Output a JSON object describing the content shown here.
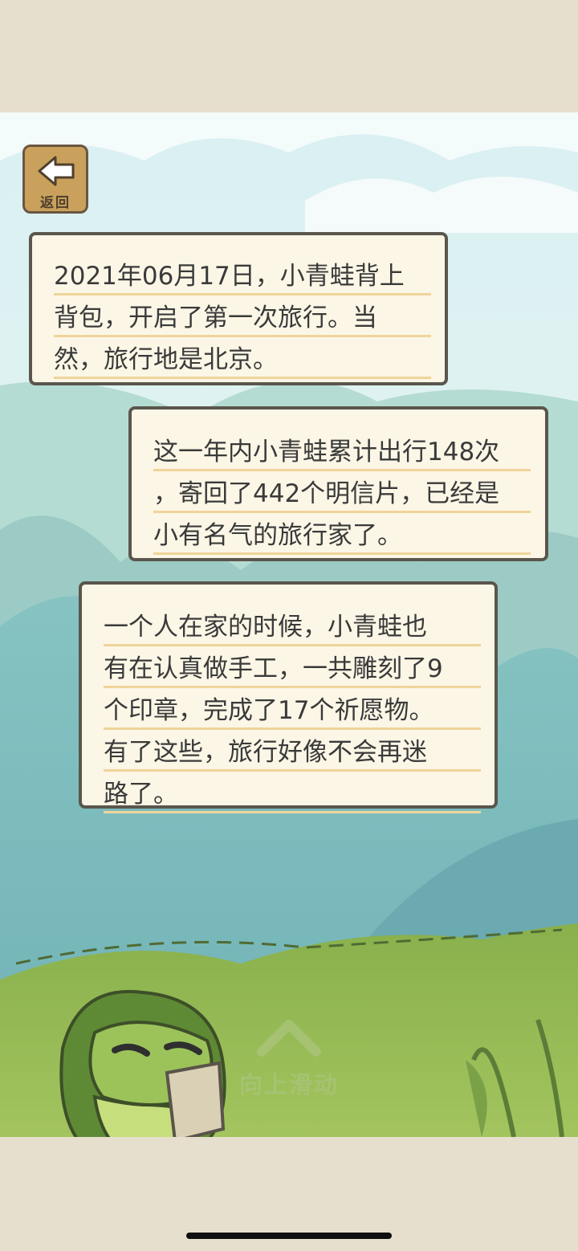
{
  "screen": {
    "width": 720,
    "height": 1558
  },
  "back_button": {
    "icon": "arrow-left-icon",
    "label": "返回"
  },
  "messages": [
    {
      "lines": [
        "2021年06月17日，小青蛙背上",
        "背包，开启了第一次旅行。当",
        "然，旅行地是北京。"
      ]
    },
    {
      "lines": [
        "这一年内小青蛙累计出行148次",
        "，寄回了442个明信片，已经是",
        "小有名气的旅行家了。"
      ]
    },
    {
      "lines": [
        "一个人在家的时候，小青蛙也",
        "有在认真做手工，一共雕刻了9",
        "个印章，完成了17个祈愿物。",
        "有了这些，旅行好像不会再迷",
        "路了。"
      ]
    }
  ],
  "swipe_hint": {
    "icon": "chevron-up-icon",
    "label": "向上滑动"
  },
  "colors": {
    "sky": "#e3f3f4",
    "mountain": "#75b6b9",
    "grass": "#8fb454",
    "bubble_bg": "#fcf6e6",
    "bubble_border": "#5a564d",
    "underline": "#efd49a",
    "wood": "#c9a15c"
  }
}
